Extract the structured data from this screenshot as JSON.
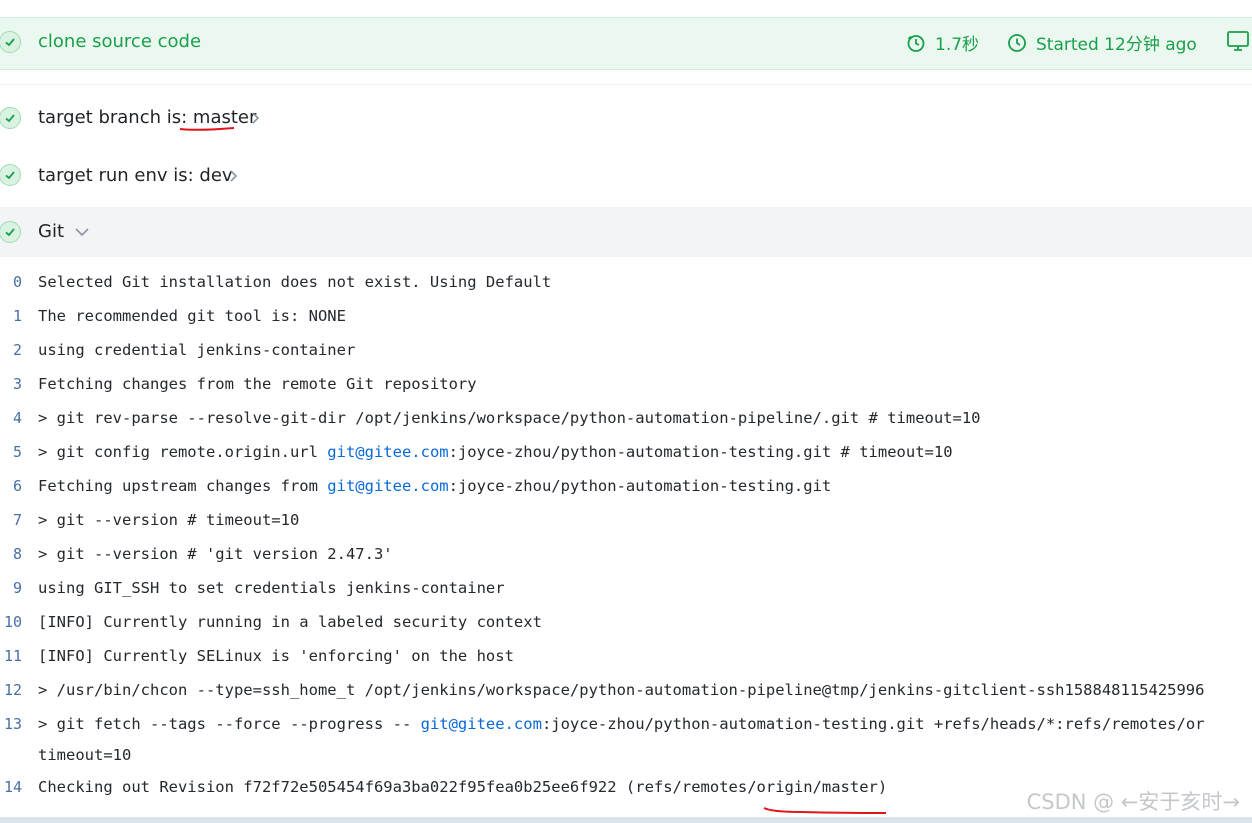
{
  "stage": {
    "title": "clone source code",
    "duration": "1.7秒",
    "started": "Started 12分钟 ago",
    "icons": [
      "timer-icon",
      "clock-icon",
      "monitor-icon"
    ]
  },
  "steps": [
    {
      "prefix": "target branch is: ",
      "value": "master",
      "icon": "chevron-right-icon"
    },
    {
      "prefix": "target run env is: ",
      "value": "dev",
      "icon": "chevron-right-icon"
    },
    {
      "prefix": "",
      "value": "Git",
      "icon": "chevron-down-icon"
    }
  ],
  "log": {
    "lines": [
      {
        "n": "0",
        "t": "Selected Git installation does not exist. Using Default"
      },
      {
        "n": "1",
        "t": "The recommended git tool is: NONE"
      },
      {
        "n": "2",
        "t": "using credential jenkins-container"
      },
      {
        "n": "3",
        "t": "Fetching changes from the remote Git repository"
      },
      {
        "n": "4",
        "t": " > git rev-parse --resolve-git-dir /opt/jenkins/workspace/python-automation-pipeline/.git # timeout=10"
      },
      {
        "n": "5",
        "a": " > git config remote.origin.url ",
        "link": "git@gitee.com",
        "b": ":joyce-zhou/python-automation-testing.git # timeout=10"
      },
      {
        "n": "6",
        "a": "Fetching upstream changes from ",
        "link": "git@gitee.com",
        "b": ":joyce-zhou/python-automation-testing.git"
      },
      {
        "n": "7",
        "t": " > git --version # timeout=10"
      },
      {
        "n": "8",
        "t": " > git --version # 'git version 2.47.3'"
      },
      {
        "n": "9",
        "t": "using GIT_SSH to set credentials jenkins-container"
      },
      {
        "n": "10",
        "t": "[INFO] Currently running in a labeled security context"
      },
      {
        "n": "11",
        "t": "[INFO] Currently SELinux is 'enforcing' on the host"
      },
      {
        "n": "12",
        "t": " > /usr/bin/chcon --type=ssh_home_t /opt/jenkins/workspace/python-automation-pipeline@tmp/jenkins-gitclient-ssh158848115425996"
      },
      {
        "n": "13",
        "a": " > git fetch --tags --force --progress -- ",
        "link": "git@gitee.com",
        "b": ":joyce-zhou/python-automation-testing.git +refs/heads/*:refs/remotes/or",
        "c": "timeout=10"
      },
      {
        "n": "14",
        "t": "Checking out Revision f72f72e505454f69a3ba022f95fea0b25ee6f922 (refs/remotes/origin/master)"
      }
    ]
  },
  "watermark": "CSDN @ ←安于亥时→",
  "colors": {
    "success": "#1a9f4c",
    "link": "#0969da",
    "annotation": "#e0151b"
  }
}
